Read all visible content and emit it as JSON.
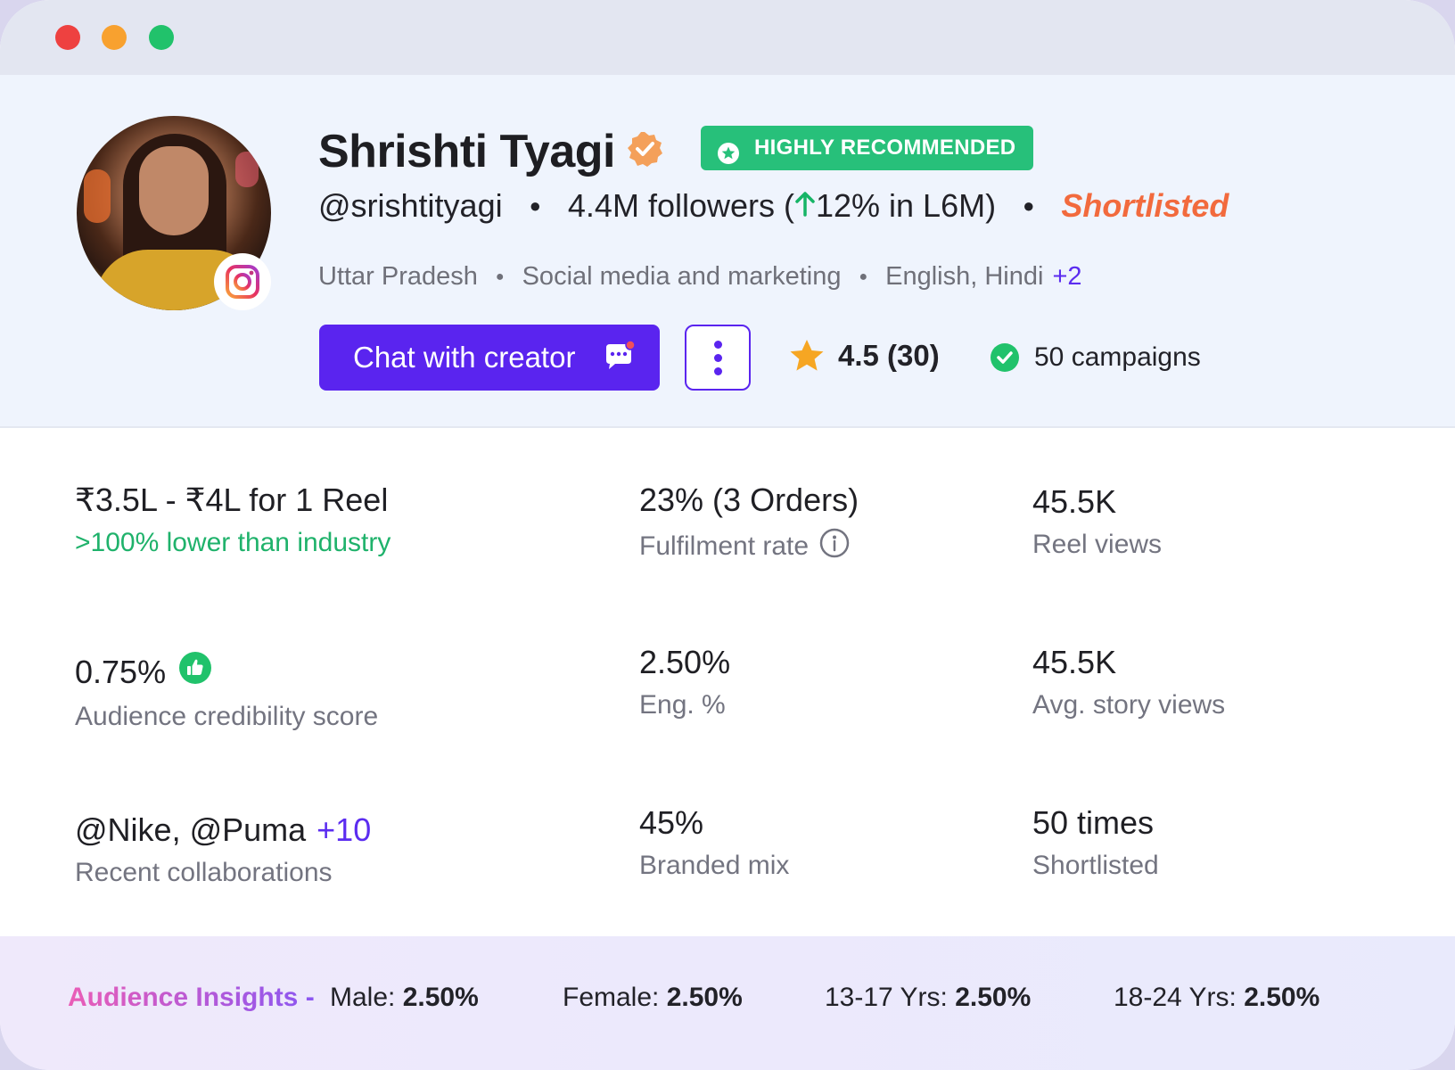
{
  "window": {
    "title_controls": [
      "close",
      "minimize",
      "maximize"
    ]
  },
  "profile": {
    "name": "Shrishti Tyagi",
    "badge": "HIGHLY RECOMMENDED",
    "handle": "@srishtityagi",
    "followers_prefix": "4.4M followers (",
    "growth": "12% in L6M)",
    "status": "Shortlisted",
    "location": "Uttar Pradesh",
    "category": "Social media and marketing",
    "languages": "English, Hindi",
    "languages_more": "+2",
    "platform_icon": "instagram-icon"
  },
  "actions": {
    "chat_label": "Chat with creator",
    "rating": "4.5 (30)",
    "campaigns": "50 campaigns"
  },
  "stats": {
    "price_value": "₹3.5L - ₹4L for 1 Reel",
    "price_note": ">100% lower than industry",
    "fulfilment_value": "23% (3 Orders)",
    "fulfilment_label": "Fulfilment rate",
    "reel_views_value": "45.5K",
    "reel_views_label": "Reel views",
    "credibility_value": "0.75%",
    "credibility_label": "Audience credibility score",
    "eng_value": "2.50%",
    "eng_label": "Eng. %",
    "story_views_value": "45.5K",
    "story_views_label": "Avg. story views",
    "collabs_value": "@Nike, @Puma",
    "collabs_more": "+10",
    "collabs_label": "Recent collaborations",
    "branded_value": "45%",
    "branded_label": "Branded mix",
    "shortlisted_value": "50 times",
    "shortlisted_label": "Shortlisted"
  },
  "insights": {
    "title": "Audience Insights -",
    "male_label": "Male:",
    "male_value": "2.50%",
    "female_label": "Female:",
    "female_value": "2.50%",
    "age1_label": "13-17 Yrs:",
    "age1_value": "2.50%",
    "age2_label": "18-24 Yrs:",
    "age2_value": "2.50%"
  },
  "colors": {
    "accent": "#5a24ef",
    "recommended": "#27c07a",
    "shortlisted": "#f26a3d",
    "positive": "#1fb26b"
  }
}
